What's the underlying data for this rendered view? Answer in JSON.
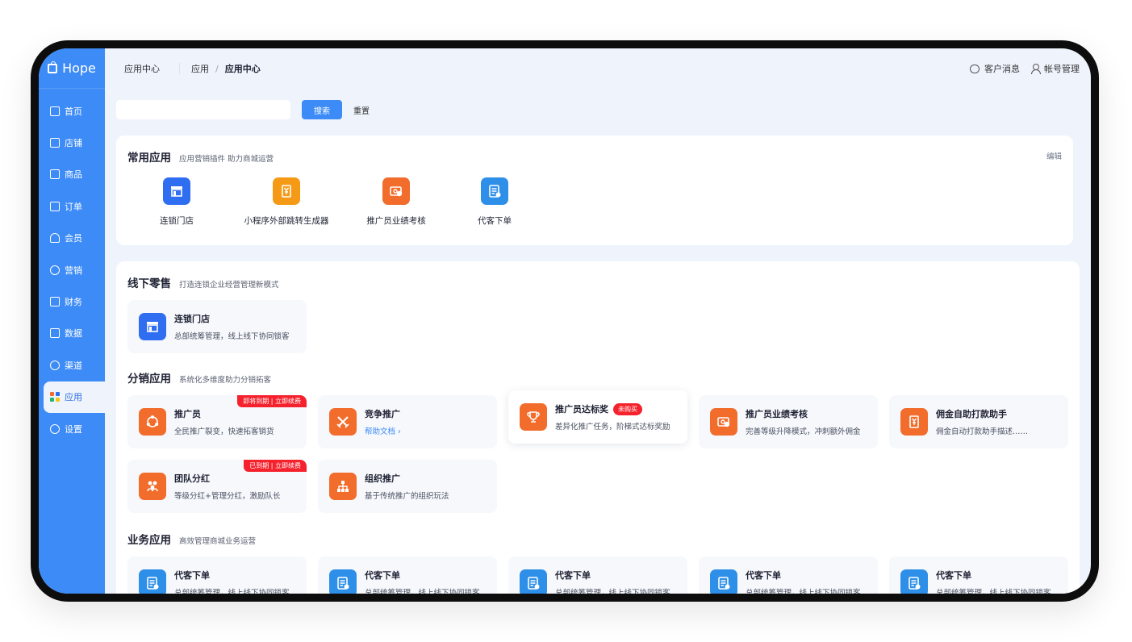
{
  "app": {
    "brand": "Hope"
  },
  "sidebar": {
    "items": [
      {
        "label": "首页",
        "icon": "home-icon"
      },
      {
        "label": "店铺",
        "icon": "store-icon"
      },
      {
        "label": "商品",
        "icon": "bag-icon"
      },
      {
        "label": "订单",
        "icon": "order-icon"
      },
      {
        "label": "会员",
        "icon": "member-icon"
      },
      {
        "label": "营销",
        "icon": "marketing-icon"
      },
      {
        "label": "财务",
        "icon": "finance-icon"
      },
      {
        "label": "数据",
        "icon": "data-icon"
      },
      {
        "label": "渠道",
        "icon": "channel-icon"
      },
      {
        "label": "应用",
        "icon": "apps-icon",
        "active": true
      },
      {
        "label": "设置",
        "icon": "settings-icon"
      }
    ]
  },
  "header": {
    "page_title": "应用中心",
    "breadcrumb": [
      "应用",
      "应用中心"
    ],
    "separator": "/",
    "customer_messages": "客户消息",
    "account_manage": "帐号管理"
  },
  "search": {
    "value": "",
    "placeholder": "",
    "search_button": "搜索",
    "reset_button": "重置"
  },
  "favorites": {
    "title": "常用应用",
    "desc": "应用营销插件 助力商城运营",
    "edit": "编辑",
    "items": [
      {
        "label": "连锁门店",
        "icon": "store-icon",
        "color": "#2f6ef0"
      },
      {
        "label": "小程序外部跳转生成器",
        "icon": "yuan-tag-icon",
        "color": "#f59a16"
      },
      {
        "label": "推广员业绩考核",
        "icon": "money-card-icon",
        "color": "#f26c2c"
      },
      {
        "label": "代客下单",
        "icon": "order-form-icon",
        "color": "#2e8fe8"
      }
    ]
  },
  "offline": {
    "title": "线下零售",
    "desc": "打造连锁企业经营管理新模式",
    "cards": [
      {
        "title": "连锁门店",
        "desc": "总部统筹管理，线上线下协同锁客",
        "icon": "store-icon"
      }
    ]
  },
  "distribution": {
    "title": "分销应用",
    "desc": "系统化多维度助力分销拓客",
    "cards": [
      {
        "title": "推广员",
        "desc": "全民推广裂变，快速拓客销货",
        "tag": "即将到期 | 立即续费",
        "icon": "share-icon"
      },
      {
        "title": "竞争推广",
        "desc": "帮助文档 ›",
        "icon": "swords-icon"
      },
      {
        "title": "推广员达标奖",
        "desc": "差异化推广任务，阶梯式达标奖励",
        "pill": "未购买",
        "icon": "trophy-icon"
      },
      {
        "title": "推广员业绩考核",
        "desc": "完善等级升降模式，冲刺额外佣金",
        "icon": "money-card-icon"
      },
      {
        "title": "佣金自助打款助手",
        "desc": "佣金自动打款助手描述……",
        "icon": "yuan-tag-icon"
      },
      {
        "title": "团队分红",
        "desc": "等级分红+管理分红，激励队长",
        "tag": "已到期 | 立即续费",
        "icon": "team-icon"
      },
      {
        "title": "组织推广",
        "desc": "基于传统推广的组织玩法",
        "icon": "org-chart-icon"
      }
    ]
  },
  "business": {
    "title": "业务应用",
    "desc": "高效管理商城业务运营",
    "cards": [
      {
        "title": "代客下单",
        "desc": "总部统筹管理，线上线下协同锁客",
        "icon": "order-form-icon"
      },
      {
        "title": "代客下单",
        "desc": "总部统筹管理，线上线下协同锁客",
        "icon": "order-form-icon"
      },
      {
        "title": "代客下单",
        "desc": "总部统筹管理，线上线下协同锁客",
        "icon": "order-form-icon"
      },
      {
        "title": "代客下单",
        "desc": "总部统筹管理，线上线下协同锁客",
        "icon": "order-form-icon"
      },
      {
        "title": "代客下单",
        "desc": "总部统筹管理，线上线下协同锁客",
        "icon": "order-form-icon"
      }
    ]
  },
  "colors": {
    "accent": "#3d8bf6",
    "danger": "#f5222d",
    "orange": "#f26c2c",
    "amber": "#f59a16",
    "blue": "#2f6ef0"
  }
}
